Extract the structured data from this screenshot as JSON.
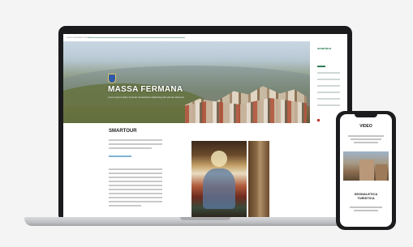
{
  "laptop": {
    "browser": {
      "url": "www.massafermana.it"
    },
    "hero": {
      "title": "MASSA FERMANA",
      "subtitle": "Lorem ipsum dolor sit amet consectetur adipiscing elit sed do eiusmod"
    },
    "sidebar": {
      "logo": "smartour"
    },
    "content": {
      "heading": "SMARTOUR"
    }
  },
  "phone": {
    "header": "VIDEO",
    "section_title_line1": "SEGNALETICA",
    "section_title_line2": "TURISTICA"
  },
  "colors": {
    "accent": "#2e7d55",
    "screen_bezel": "#1b1b1d",
    "laptop_base": "#c5c6c9"
  },
  "icons": [
    "crest-icon"
  ]
}
